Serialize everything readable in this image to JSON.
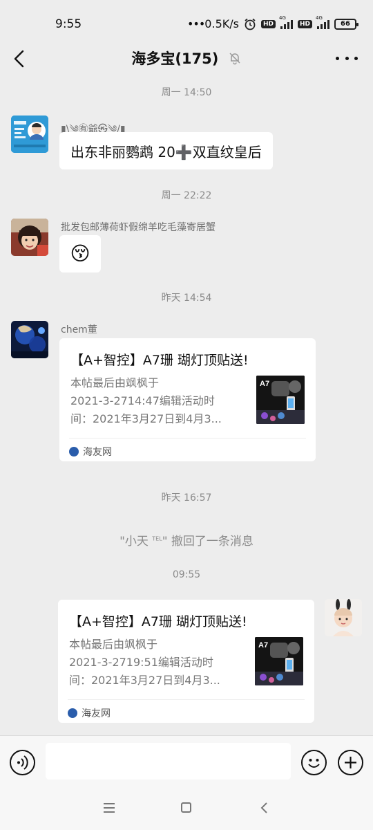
{
  "status_bar": {
    "time": "9:55",
    "net_speed": "0.5K/s",
    "battery": "66",
    "hd1": "HD",
    "hd2": "HD",
    "net_label": "4G"
  },
  "header": {
    "title": "海多宝(175)",
    "icons": {
      "back": "back-arrow-icon",
      "mute": "bell-muted-icon",
      "more": "more-dots-icon"
    }
  },
  "messages": [
    {
      "timestamp": "周一 14:50",
      "sender": "▮\\༄㊒爺㉿༄/▮",
      "text": "出东非丽鹦鹉  20➕双直纹皇后"
    },
    {
      "timestamp": "周一 22:22",
      "sender": "批发包邮薄荷虾假绵羊吃毛藻寄居蟹",
      "emoji": "😚"
    },
    {
      "timestamp": "昨天 14:54",
      "sender": "chem董",
      "link": {
        "title": "【A+智控】A7珊 瑚灯顶贴送!",
        "desc_lines": [
          "本帖最后由飒枫于",
          "2021-3-2714:47编辑活动时",
          "间：2021年3月27日到4月3..."
        ],
        "thumb_label": "A7",
        "source": "海友网"
      }
    },
    {
      "timestamp": "昨天 16:57",
      "recall": {
        "prefix": "\"小天 ",
        "sup": "TEL",
        "suffix": "\" 撤回了一条消息"
      }
    },
    {
      "timestamp": "09:55",
      "link": {
        "title": "【A+智控】A7珊 瑚灯顶贴送!",
        "desc_lines": [
          "本帖最后由飒枫于",
          "2021-3-2719:51编辑活动时",
          "间：2021年3月27日到4月3..."
        ],
        "thumb_label": "A7",
        "source": "海友网"
      }
    }
  ],
  "input_bar": {
    "placeholder": "",
    "icons": {
      "voice": "voice-icon",
      "emoji": "emoji-icon",
      "plus": "plus-icon"
    }
  },
  "nav_bar": {
    "icons": [
      "menu-icon",
      "home-icon",
      "back-icon"
    ]
  },
  "colors": {
    "background": "#ededed",
    "bubble": "#ffffff",
    "timestamp": "#8a8a8a"
  }
}
